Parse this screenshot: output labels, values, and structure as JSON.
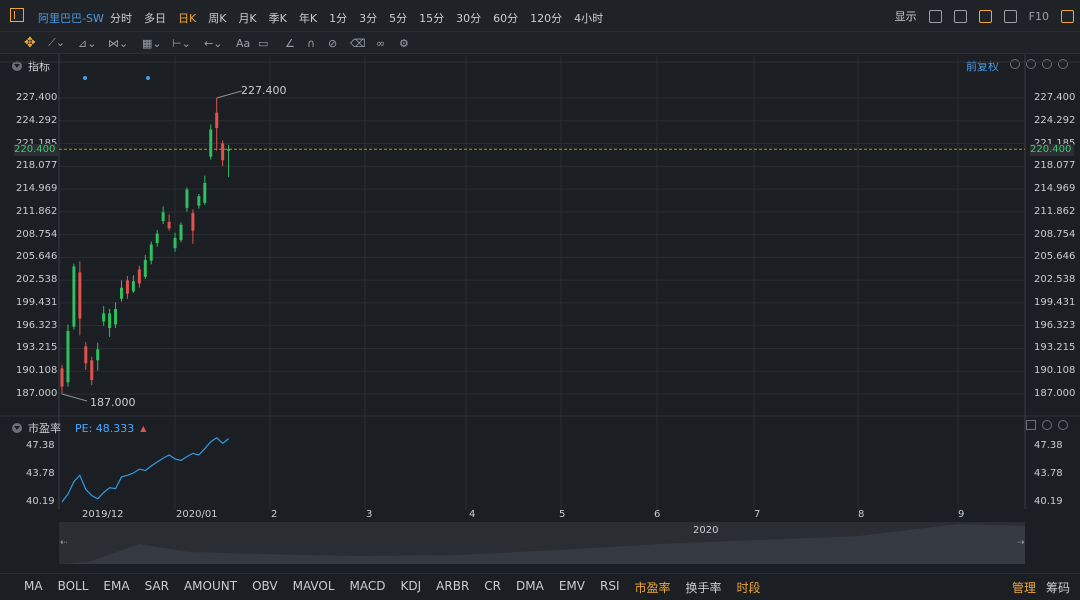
{
  "topbar": {
    "symbol": "阿里巴巴-SW",
    "periods": [
      "分时",
      "多日",
      "日K",
      "周K",
      "月K",
      "季K",
      "年K",
      "1分",
      "3分",
      "5分",
      "15分",
      "30分",
      "60分",
      "120分",
      "4小时"
    ],
    "active_period": "日K",
    "display_label": "显示",
    "fid_label": "F10"
  },
  "toolbar": {
    "text_tool": "Aa"
  },
  "main_panel": {
    "title": "指标",
    "adjust_label": "前复权",
    "high_label": "227.400",
    "low_label": "187.000",
    "current_price": "220.400",
    "y_ticks": [
      "227.400",
      "224.292",
      "221.185",
      "218.077",
      "214.969",
      "211.862",
      "208.754",
      "205.646",
      "202.538",
      "199.431",
      "196.323",
      "193.215",
      "190.108",
      "187.000"
    ]
  },
  "pe_panel": {
    "title": "市盈率",
    "pe_label": "PE: 48.333",
    "y_ticks": [
      "47.38",
      "43.78",
      "40.19"
    ]
  },
  "x_axis": {
    "labels": [
      "2019/12",
      "2020/01",
      "2",
      "3",
      "4",
      "5",
      "6",
      "7",
      "8",
      "9"
    ]
  },
  "navigator": {
    "year_label": "2020"
  },
  "bottom": {
    "indicators": [
      "MA",
      "BOLL",
      "EMA",
      "SAR",
      "AMOUNT",
      "OBV",
      "MAVOL",
      "MACD",
      "KDJ",
      "ARBR",
      "CR",
      "DMA",
      "EMV",
      "RSI",
      "市盈率",
      "换手率",
      "时段"
    ],
    "highlighted": [
      "市盈率",
      "时段"
    ],
    "manage_label": "管理",
    "chips_label": "筹码"
  },
  "chart_data": {
    "type": "candlestick",
    "ylim": [
      187.0,
      227.4
    ],
    "candles": [
      {
        "o": 190.5,
        "c": 188.0,
        "h": 191.0,
        "l": 187.0
      },
      {
        "o": 188.6,
        "c": 195.6,
        "h": 196.5,
        "l": 188.0
      },
      {
        "o": 196.2,
        "c": 204.4,
        "h": 204.8,
        "l": 195.8
      },
      {
        "o": 203.6,
        "c": 197.3,
        "h": 205.1,
        "l": 195.0
      },
      {
        "o": 193.5,
        "c": 191.2,
        "h": 194.1,
        "l": 190.3
      },
      {
        "o": 191.6,
        "c": 188.9,
        "h": 192.1,
        "l": 188.2
      },
      {
        "o": 191.6,
        "c": 193.1,
        "h": 194.0,
        "l": 190.2
      },
      {
        "o": 196.9,
        "c": 198.0,
        "h": 199.0,
        "l": 196.3
      },
      {
        "o": 196.0,
        "c": 198.0,
        "h": 198.6,
        "l": 194.8
      },
      {
        "o": 196.5,
        "c": 198.6,
        "h": 199.5,
        "l": 196.0
      },
      {
        "o": 200.0,
        "c": 201.5,
        "h": 202.5,
        "l": 199.6
      },
      {
        "o": 202.5,
        "c": 200.7,
        "h": 203.1,
        "l": 200.0
      },
      {
        "o": 201.0,
        "c": 202.4,
        "h": 203.2,
        "l": 200.8
      },
      {
        "o": 204.0,
        "c": 202.1,
        "h": 204.5,
        "l": 201.5
      },
      {
        "o": 203.0,
        "c": 205.3,
        "h": 206.0,
        "l": 202.7
      },
      {
        "o": 205.2,
        "c": 207.4,
        "h": 207.8,
        "l": 204.7
      },
      {
        "o": 207.6,
        "c": 208.9,
        "h": 209.4,
        "l": 207.1
      },
      {
        "o": 210.6,
        "c": 211.8,
        "h": 212.6,
        "l": 210.2
      },
      {
        "o": 210.5,
        "c": 209.6,
        "h": 211.5,
        "l": 209.3
      },
      {
        "o": 206.9,
        "c": 208.3,
        "h": 209.0,
        "l": 206.4
      },
      {
        "o": 208.0,
        "c": 210.1,
        "h": 210.4,
        "l": 207.7
      },
      {
        "o": 212.4,
        "c": 214.9,
        "h": 215.2,
        "l": 211.9
      },
      {
        "o": 211.7,
        "c": 209.3,
        "h": 212.2,
        "l": 207.5
      },
      {
        "o": 212.7,
        "c": 214.0,
        "h": 214.3,
        "l": 212.3
      },
      {
        "o": 213.1,
        "c": 215.8,
        "h": 216.8,
        "l": 212.8
      },
      {
        "o": 219.4,
        "c": 223.1,
        "h": 223.8,
        "l": 219.0
      },
      {
        "o": 225.4,
        "c": 223.3,
        "h": 227.4,
        "l": 220.2
      },
      {
        "o": 221.2,
        "c": 218.9,
        "h": 221.6,
        "l": 218.1
      },
      {
        "o": 220.2,
        "c": 220.4,
        "h": 221.0,
        "l": 216.6
      }
    ],
    "pe_series": {
      "name": "PE",
      "ylim": [
        40.19,
        48.5
      ],
      "values": [
        40.2,
        41.2,
        42.8,
        43.6,
        41.8,
        41.0,
        40.6,
        41.4,
        42.0,
        41.9,
        43.4,
        43.6,
        43.9,
        44.4,
        44.2,
        44.8,
        45.3,
        45.8,
        46.2,
        45.7,
        45.5,
        46.0,
        46.4,
        46.2,
        47.0,
        47.9,
        48.4,
        47.7,
        48.3
      ]
    }
  }
}
